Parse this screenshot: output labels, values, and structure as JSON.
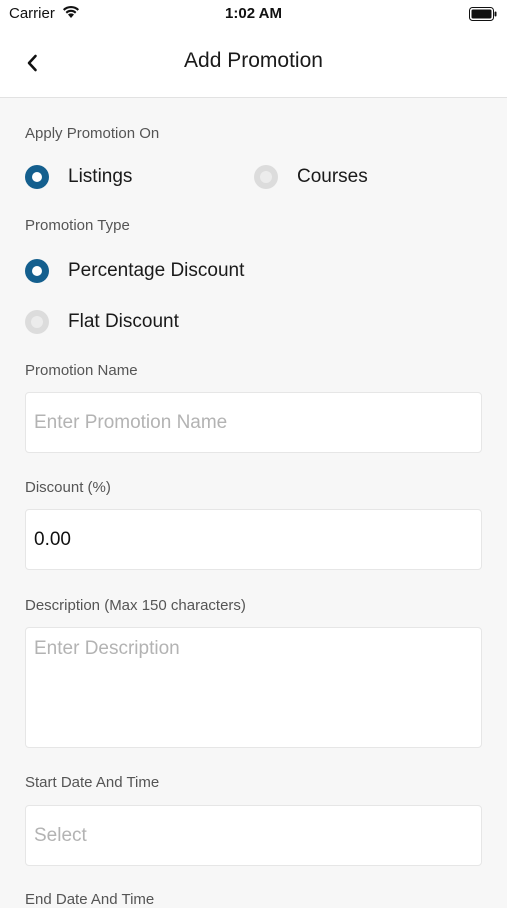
{
  "status_bar": {
    "carrier": "Carrier",
    "time": "1:02 AM"
  },
  "nav": {
    "title": "Add Promotion"
  },
  "apply_on": {
    "label": "Apply Promotion On",
    "options": [
      {
        "label": "Listings",
        "selected": true
      },
      {
        "label": "Courses",
        "selected": false
      }
    ]
  },
  "promotion_type": {
    "label": "Promotion Type",
    "options": [
      {
        "label": "Percentage Discount",
        "selected": true
      },
      {
        "label": "Flat Discount",
        "selected": false
      }
    ]
  },
  "promotion_name": {
    "label": "Promotion Name",
    "placeholder": "Enter Promotion Name",
    "value": ""
  },
  "discount": {
    "label": "Discount (%)",
    "value": "0.00"
  },
  "description": {
    "label": "Description (Max 150 characters)",
    "placeholder": "Enter Description"
  },
  "start_date": {
    "label": "Start Date And Time",
    "placeholder": "Select"
  },
  "end_date": {
    "label": "End Date And Time"
  },
  "colors": {
    "accent": "#145f8e",
    "background": "#f7f7f7"
  },
  "icons": {
    "back": "chevron-left-icon",
    "wifi": "wifi-icon",
    "battery": "battery-icon"
  }
}
